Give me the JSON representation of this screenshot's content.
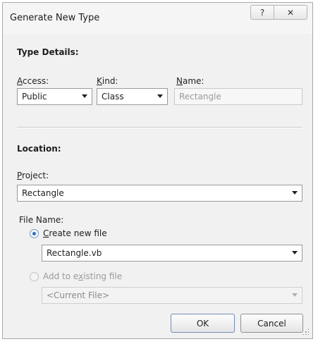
{
  "dialog": {
    "title": "Generate New Type",
    "help_glyph": "?",
    "close_glyph": "✕"
  },
  "type_details": {
    "heading": "Type Details:",
    "access": {
      "label_ul": "A",
      "label_rest": "ccess:",
      "value": "Public"
    },
    "kind": {
      "label_ul": "K",
      "label_rest": "ind:",
      "value": "Class"
    },
    "name": {
      "label_ul": "N",
      "label_rest": "ame:",
      "value": "Rectangle"
    }
  },
  "location": {
    "heading": "Location:",
    "project": {
      "label_ul": "P",
      "label_rest": "roject:",
      "value": "Rectangle"
    },
    "file_name_label": "File Name:",
    "create_new": {
      "label_ul": "C",
      "label_rest": "reate new file",
      "value": "Rectangle.vb",
      "selected": true
    },
    "add_existing": {
      "label_pre": "Add to e",
      "label_ul": "x",
      "label_rest": "isting file",
      "value": "<Current File>",
      "selected": false
    }
  },
  "buttons": {
    "ok": "OK",
    "cancel": "Cancel"
  }
}
